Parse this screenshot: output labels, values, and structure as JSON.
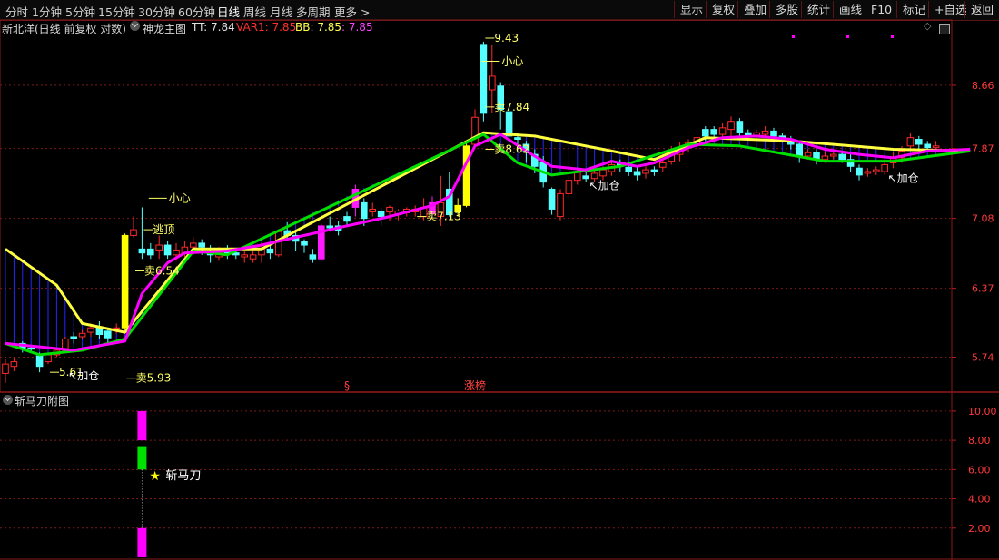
{
  "toolbar": {
    "periods": [
      "分时",
      "1分钟",
      "5分钟",
      "15分钟",
      "30分钟",
      "60分钟",
      "日线",
      "周线",
      "月线",
      "多周期",
      "更多"
    ],
    "active": "日线",
    "tools": [
      "显示",
      "复权",
      "叠加",
      "多股",
      "统计",
      "画线",
      "F10",
      "标记",
      "+自选",
      "返回"
    ]
  },
  "main": {
    "stock_label": "新北洋(日线 前复权 对数)",
    "indicator_name": "神龙主图",
    "tt": "TT: 7.84",
    "var1": "VAR1: 7.85",
    "bb": "BB: 7.85",
    "last": ": 7.85",
    "colors": {
      "up": "#ff2a2a",
      "down": "#54ffff",
      "grid": "#7a1a1a",
      "ma_main": "#ff00ff",
      "ma_up": "#00e000",
      "band_top": "#ffff40",
      "label": "#ffff66",
      "stick": "#2525ff"
    }
  },
  "sub": {
    "indicator_name": "斩马刀附图",
    "signal_label": "斩马刀",
    "star_icon": "star-icon"
  },
  "chart_data": {
    "type": "candlestick",
    "ylim_log": [
      5.55,
      9.3
    ],
    "y_ticks": [
      5.74,
      6.37,
      7.08,
      7.87,
      8.66
    ],
    "candles": [
      [
        5.6,
        5.68,
        5.52,
        5.72,
        "u"
      ],
      [
        5.7,
        5.66,
        5.62,
        5.74,
        "u"
      ],
      [
        5.86,
        5.82,
        5.78,
        5.88,
        "d"
      ],
      [
        5.82,
        5.81,
        5.78,
        5.84,
        "d"
      ],
      [
        5.75,
        5.66,
        5.61,
        5.78,
        "d"
      ],
      [
        5.7,
        5.76,
        5.68,
        5.78,
        "u"
      ],
      [
        5.76,
        5.8,
        5.74,
        5.82,
        "u"
      ],
      [
        5.8,
        5.9,
        5.78,
        5.92,
        "u"
      ],
      [
        5.92,
        5.9,
        5.86,
        5.96,
        "d"
      ],
      [
        5.92,
        5.95,
        5.9,
        5.98,
        "u"
      ],
      [
        5.96,
        6.0,
        5.92,
        6.04,
        "u"
      ],
      [
        6.0,
        5.94,
        5.9,
        6.06,
        "d"
      ],
      [
        5.97,
        5.91,
        5.86,
        6.0,
        "d"
      ],
      [
        6.0,
        6.0,
        5.95,
        6.04,
        "u"
      ],
      [
        6.0,
        6.9,
        5.98,
        6.92,
        "y"
      ],
      [
        6.9,
        6.96,
        6.88,
        7.1,
        "u"
      ],
      [
        6.72,
        6.76,
        6.66,
        7.2,
        "d"
      ],
      [
        6.7,
        6.76,
        6.66,
        6.82,
        "d"
      ],
      [
        6.75,
        6.8,
        6.66,
        6.9,
        "u"
      ],
      [
        6.8,
        6.7,
        6.66,
        6.84,
        "d"
      ],
      [
        6.7,
        6.75,
        6.64,
        6.82,
        "u"
      ],
      [
        6.72,
        6.78,
        6.68,
        6.84,
        "u"
      ],
      [
        6.78,
        6.82,
        6.7,
        6.88,
        "u"
      ],
      [
        6.82,
        6.78,
        6.7,
        6.86,
        "d"
      ],
      [
        6.74,
        6.7,
        6.62,
        6.8,
        "d"
      ],
      [
        6.68,
        6.72,
        6.64,
        6.78,
        "u"
      ],
      [
        6.72,
        6.74,
        6.66,
        6.8,
        "d"
      ],
      [
        6.72,
        6.7,
        6.66,
        6.76,
        "d"
      ],
      [
        6.7,
        6.68,
        6.62,
        6.74,
        "u"
      ],
      [
        6.66,
        6.7,
        6.62,
        6.76,
        "u"
      ],
      [
        6.7,
        6.76,
        6.62,
        6.82,
        "u"
      ],
      [
        6.76,
        6.72,
        6.66,
        6.8,
        "d"
      ],
      [
        6.7,
        6.94,
        6.68,
        6.96,
        "u"
      ],
      [
        6.95,
        6.9,
        6.86,
        7.04,
        "d"
      ],
      [
        6.9,
        6.84,
        6.74,
        6.94,
        "d"
      ],
      [
        6.84,
        6.8,
        6.72,
        6.86,
        "d"
      ],
      [
        6.7,
        6.66,
        6.62,
        6.76,
        "d"
      ],
      [
        6.66,
        7.0,
        6.64,
        7.02,
        "m"
      ],
      [
        7.0,
        6.98,
        6.94,
        7.1,
        "d"
      ],
      [
        7.0,
        6.95,
        6.9,
        7.05,
        "d"
      ],
      [
        7.1,
        7.05,
        7.0,
        7.15,
        "d"
      ],
      [
        7.2,
        7.4,
        7.1,
        7.45,
        "m"
      ],
      [
        7.25,
        7.08,
        7.0,
        7.3,
        "d"
      ],
      [
        7.15,
        7.18,
        7.1,
        7.25,
        "u"
      ],
      [
        7.15,
        7.1,
        7.0,
        7.2,
        "d"
      ],
      [
        7.15,
        7.2,
        7.05,
        7.22,
        "u"
      ],
      [
        7.12,
        7.16,
        7.06,
        7.18,
        "u"
      ],
      [
        7.14,
        7.18,
        7.1,
        7.2,
        "u"
      ],
      [
        7.15,
        7.18,
        7.1,
        7.22,
        "u"
      ],
      [
        7.1,
        7.2,
        7.06,
        7.3,
        "u"
      ],
      [
        7.25,
        7.13,
        7.08,
        7.32,
        "m"
      ],
      [
        7.1,
        7.25,
        7.0,
        7.55,
        "u"
      ],
      [
        7.4,
        7.12,
        7.1,
        7.6,
        "d"
      ],
      [
        7.15,
        7.22,
        7.1,
        7.3,
        "y"
      ],
      [
        7.22,
        7.9,
        7.2,
        7.95,
        "y"
      ],
      [
        7.92,
        8.25,
        7.88,
        8.35,
        "u"
      ],
      [
        8.3,
        9.2,
        8.2,
        9.25,
        "d"
      ],
      [
        8.6,
        8.78,
        8.3,
        9.2,
        "u"
      ],
      [
        8.65,
        8.35,
        8.1,
        8.7,
        "d"
      ],
      [
        8.32,
        8.02,
        7.96,
        8.4,
        "d"
      ],
      [
        8.0,
        7.98,
        7.9,
        8.06,
        "d"
      ],
      [
        7.92,
        7.84,
        7.7,
        7.96,
        "d"
      ],
      [
        7.8,
        7.66,
        7.58,
        7.86,
        "d"
      ],
      [
        7.7,
        7.48,
        7.42,
        7.78,
        "d"
      ],
      [
        7.4,
        7.18,
        7.12,
        7.42,
        "d"
      ],
      [
        7.1,
        7.35,
        7.06,
        7.4,
        "u"
      ],
      [
        7.35,
        7.5,
        7.3,
        7.55,
        "u"
      ],
      [
        7.5,
        7.6,
        7.45,
        7.62,
        "u"
      ],
      [
        7.55,
        7.52,
        7.48,
        7.62,
        "d"
      ],
      [
        7.52,
        7.58,
        7.48,
        7.66,
        "u"
      ],
      [
        7.55,
        7.62,
        7.5,
        7.66,
        "u"
      ],
      [
        7.6,
        7.68,
        7.55,
        7.72,
        "u"
      ],
      [
        7.7,
        7.66,
        7.6,
        7.74,
        "d"
      ],
      [
        7.65,
        7.6,
        7.55,
        7.7,
        "d"
      ],
      [
        7.6,
        7.56,
        7.5,
        7.66,
        "d"
      ],
      [
        7.58,
        7.62,
        7.52,
        7.66,
        "u"
      ],
      [
        7.62,
        7.6,
        7.55,
        7.66,
        "d"
      ],
      [
        7.65,
        7.7,
        7.6,
        7.8,
        "u"
      ],
      [
        7.72,
        7.82,
        7.68,
        7.9,
        "u"
      ],
      [
        7.8,
        7.88,
        7.72,
        7.95,
        "u"
      ],
      [
        7.9,
        7.94,
        7.82,
        7.98,
        "u"
      ],
      [
        7.92,
        8.0,
        7.86,
        8.02,
        "u"
      ],
      [
        8.02,
        8.1,
        7.96,
        8.14,
        "d"
      ],
      [
        8.1,
        8.04,
        7.96,
        8.14,
        "d"
      ],
      [
        8.04,
        8.12,
        8.0,
        8.18,
        "u"
      ],
      [
        8.1,
        8.2,
        8.02,
        8.26,
        "u"
      ],
      [
        8.2,
        8.06,
        8.0,
        8.24,
        "d"
      ],
      [
        8.06,
        8.02,
        7.98,
        8.1,
        "d"
      ],
      [
        8.02,
        8.06,
        7.98,
        8.1,
        "u"
      ],
      [
        8.04,
        8.08,
        8.0,
        8.14,
        "u"
      ],
      [
        8.08,
        8.02,
        7.98,
        8.12,
        "d"
      ],
      [
        8.02,
        7.98,
        7.94,
        8.06,
        "d"
      ],
      [
        7.98,
        7.92,
        7.86,
        8.02,
        "d"
      ],
      [
        7.92,
        7.78,
        7.7,
        7.96,
        "d"
      ],
      [
        7.78,
        7.82,
        7.74,
        7.86,
        "u"
      ],
      [
        7.82,
        7.74,
        7.68,
        7.86,
        "d"
      ],
      [
        7.74,
        7.78,
        7.7,
        7.84,
        "u"
      ],
      [
        7.78,
        7.8,
        7.74,
        7.86,
        "u"
      ],
      [
        7.8,
        7.74,
        7.7,
        7.84,
        "d"
      ],
      [
        7.74,
        7.66,
        7.6,
        7.8,
        "d"
      ],
      [
        7.64,
        7.56,
        7.5,
        7.68,
        "d"
      ],
      [
        7.58,
        7.6,
        7.54,
        7.64,
        "u"
      ],
      [
        7.6,
        7.62,
        7.56,
        7.66,
        "u"
      ],
      [
        7.6,
        7.68,
        7.56,
        7.74,
        "u"
      ],
      [
        7.7,
        7.76,
        7.64,
        7.82,
        "u"
      ],
      [
        7.76,
        7.84,
        7.7,
        7.9,
        "u"
      ],
      [
        7.9,
        8.0,
        7.84,
        8.06,
        "u"
      ],
      [
        7.98,
        7.92,
        7.86,
        8.02,
        "d"
      ],
      [
        7.92,
        7.88,
        7.84,
        7.96,
        "d"
      ],
      [
        7.88,
        7.9,
        7.84,
        7.96,
        "u"
      ]
    ],
    "ma_main": [
      [
        0,
        5.86
      ],
      [
        8,
        5.8
      ],
      [
        14,
        5.88
      ],
      [
        16,
        6.32
      ],
      [
        19,
        6.62
      ],
      [
        21,
        6.72
      ],
      [
        26,
        6.74
      ],
      [
        30,
        6.8
      ],
      [
        35,
        6.9
      ],
      [
        40,
        7.0
      ],
      [
        45,
        7.1
      ],
      [
        50,
        7.22
      ],
      [
        52,
        7.32
      ],
      [
        55,
        7.9
      ],
      [
        58,
        8.04
      ],
      [
        61,
        7.84
      ],
      [
        64,
        7.66
      ],
      [
        68,
        7.62
      ],
      [
        71,
        7.72
      ],
      [
        74,
        7.66
      ],
      [
        76,
        7.7
      ],
      [
        80,
        7.88
      ],
      [
        84,
        8.0
      ],
      [
        88,
        8.02
      ],
      [
        92,
        7.98
      ],
      [
        96,
        7.86
      ],
      [
        100,
        7.8
      ],
      [
        104,
        7.76
      ],
      [
        108,
        7.84
      ],
      [
        113,
        7.86
      ]
    ],
    "band_top": [
      [
        0,
        6.76
      ],
      [
        6,
        6.4
      ],
      [
        9,
        6.04
      ],
      [
        14,
        5.96
      ],
      [
        22,
        6.76
      ],
      [
        30,
        6.76
      ],
      [
        56,
        8.06
      ],
      [
        62,
        8.02
      ],
      [
        70,
        7.86
      ],
      [
        76,
        7.74
      ],
      [
        82,
        8.0
      ],
      [
        92,
        7.96
      ],
      [
        104,
        7.86
      ],
      [
        113,
        7.84
      ]
    ],
    "band_bot": [
      [
        0,
        5.86
      ],
      [
        4,
        5.76
      ],
      [
        9,
        5.8
      ],
      [
        14,
        5.9
      ],
      [
        22,
        6.74
      ],
      [
        26,
        6.7
      ],
      [
        56,
        8.04
      ],
      [
        60,
        7.7
      ],
      [
        64,
        7.56
      ],
      [
        72,
        7.66
      ],
      [
        80,
        7.92
      ],
      [
        86,
        7.9
      ],
      [
        96,
        7.72
      ],
      [
        104,
        7.72
      ],
      [
        113,
        7.84
      ]
    ],
    "annotations": [
      {
        "text": "小心",
        "ci": 17,
        "price": 7.3,
        "kind": "dash"
      },
      {
        "text": "逃顶",
        "ci": 16,
        "price": 6.96,
        "kind": "bracket"
      },
      {
        "text": "卖6.54",
        "ci": 15,
        "price": 6.54,
        "kind": "bracket"
      },
      {
        "text": "5.61",
        "ci": 5,
        "price": 5.61,
        "kind": "bracket"
      },
      {
        "text": "加仓",
        "ci": 8,
        "price": 5.58,
        "kind": "arrow"
      },
      {
        "text": "卖5.93",
        "ci": 14,
        "price": 5.56,
        "kind": "bracket"
      },
      {
        "text": "卖7.13",
        "ci": 48,
        "price": 7.1,
        "kind": "bracket"
      },
      {
        "text": "小心",
        "ci": 56,
        "price": 8.98,
        "kind": "dash"
      },
      {
        "text": "卖7.84",
        "ci": 56,
        "price": 8.38,
        "kind": "bracket"
      },
      {
        "text": "卖8.62",
        "ci": 56,
        "price": 7.86,
        "kind": "bracket"
      },
      {
        "text": "9.43",
        "ci": 56,
        "price": 9.3,
        "kind": "bracket"
      },
      {
        "text": "加仓",
        "ci": 69,
        "price": 7.44,
        "kind": "arrow"
      },
      {
        "text": "加仓",
        "ci": 104,
        "price": 7.52,
        "kind": "arrow"
      }
    ],
    "markers": [
      {
        "text": "§",
        "ci": 40
      },
      {
        "text": "涨榜",
        "ci": 55
      }
    ],
    "sub_ticks": [
      10.0,
      8.0,
      6.0,
      4.0,
      2.0
    ],
    "sub_ylim": [
      0,
      10.8
    ],
    "sub_bars": [
      {
        "ci": 16,
        "from": 8.0,
        "to": 10.0,
        "color": "#ff00ff"
      },
      {
        "ci": 16,
        "from": 6.0,
        "to": 7.6,
        "color": "#00e000"
      },
      {
        "ci": 16,
        "from": 0.0,
        "to": 2.0,
        "color": "#ff00ff"
      }
    ]
  }
}
